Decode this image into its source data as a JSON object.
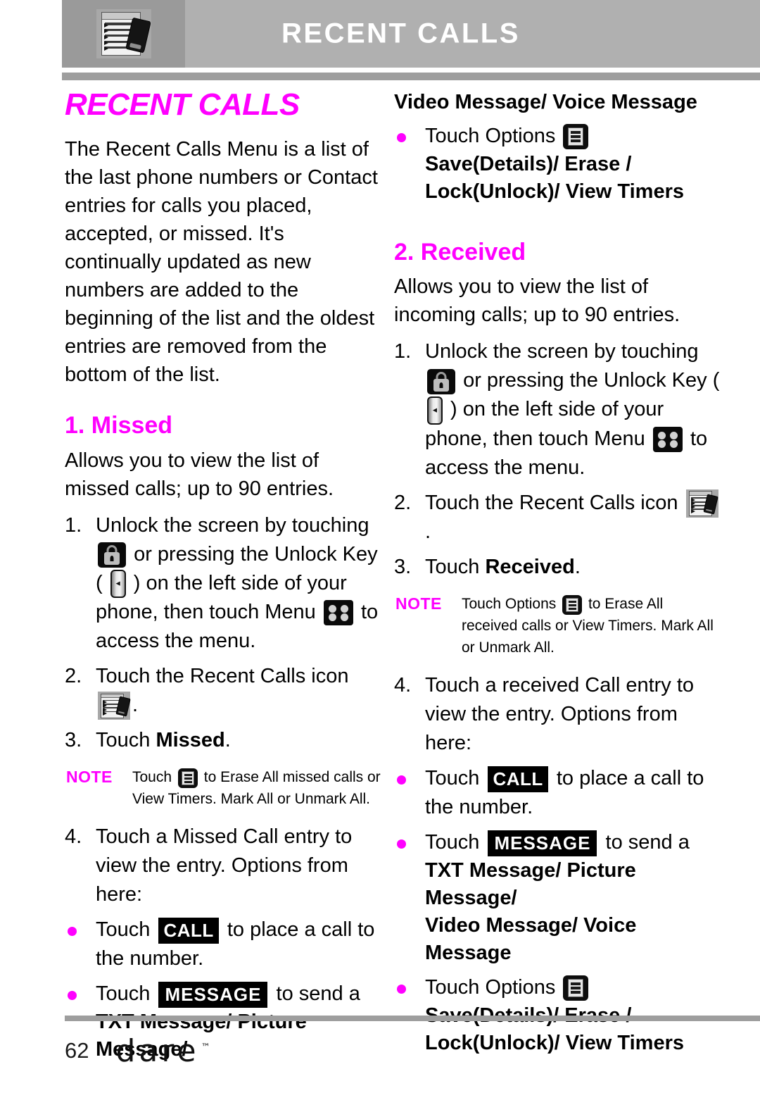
{
  "header": {
    "title": "RECENT CALLS",
    "icon": "recent-calls-document-phone-icon",
    "band_color": "#b0b0b0",
    "tile_color": "#9a9a9a",
    "title_color": "#ffffff"
  },
  "theme": {
    "accent": "#ff00ff",
    "text": "#000000",
    "rule": "#9e9e9e"
  },
  "left_column": {
    "page_heading": "RECENT CALLS",
    "intro": "The Recent Calls Menu is a list of the last phone numbers or Contact entries for calls you placed, accepted, or missed. It's continually updated as new numbers are added to the beginning of the list and the oldest entries are removed from the bottom of the list.",
    "section": {
      "heading": "1. Missed",
      "description": "Allows you to view the list of missed calls; up to 90 entries.",
      "steps": [
        {
          "num": "1.",
          "parts": {
            "a": "Unlock the screen by touching",
            "b": "or pressing the Unlock Key",
            "c": "( ",
            "d": " ) on the left side of your phone, then touch Menu",
            "e": "to access the menu."
          }
        },
        {
          "num": "2.",
          "parts": {
            "a": "Touch the Recent Calls icon",
            "b": "."
          }
        },
        {
          "num": "3.",
          "parts": {
            "a": "Touch ",
            "bold": "Missed",
            "b": "."
          }
        }
      ],
      "note": {
        "label": "NOTE",
        "line1_pre": "Touch",
        "line1_post": "to Erase All missed calls or",
        "line2": "View Timers. Mark All or Unmark All."
      },
      "step4": {
        "num": "4.",
        "text": "Touch a Missed Call entry to view the entry. Options from here:"
      },
      "bullets": [
        {
          "pre": "Touch",
          "badge": "CALL",
          "post": "to place a call to the number."
        },
        {
          "pre": "Touch",
          "badge": "MESSAGE",
          "post": "to send a",
          "bold_line": "TXT Message/ Picture Message/"
        }
      ]
    }
  },
  "right_column": {
    "continued_bold": "Video Message/ Voice Message",
    "continued_bullet": {
      "pre": "Touch Options",
      "bold_line1": "Save(Details)/ Erase /",
      "bold_line2": "Lock(Unlock)/ View Timers"
    },
    "section": {
      "heading": "2. Received",
      "description": "Allows you to view the list of incoming calls; up to 90 entries.",
      "steps": [
        {
          "num": "1.",
          "parts": {
            "a": "Unlock the screen by touching",
            "b": "or pressing the Unlock Key",
            "c": "( ",
            "d": " ) on the left side of your phone, then touch Menu",
            "e": "to access the menu."
          }
        },
        {
          "num": "2.",
          "parts": {
            "a": "Touch the Recent Calls icon",
            "b": "."
          }
        },
        {
          "num": "3.",
          "parts": {
            "a": "Touch ",
            "bold": "Received",
            "b": "."
          }
        }
      ],
      "note": {
        "label": "NOTE",
        "line1_pre": "Touch Options",
        "line1_post": "to Erase All",
        "line2": "received calls or View Timers. Mark All",
        "line3": "or Unmark All."
      },
      "step4": {
        "num": "4.",
        "text": "Touch a received Call entry to view the entry. Options from here:"
      },
      "bullets": [
        {
          "pre": "Touch",
          "badge": "CALL",
          "post": "to place a call to the number."
        },
        {
          "pre": "Touch",
          "badge": "MESSAGE",
          "post": "to send a",
          "bold_line1": "TXT Message/ Picture Message/",
          "bold_line2": "Video Message/ Voice Message"
        },
        {
          "pre": "Touch Options",
          "bold_line1": "Save(Details)/ Erase /",
          "bold_line2": "Lock(Unlock)/ View Timers"
        }
      ]
    }
  },
  "footer": {
    "page_number": "62",
    "brand": "Dare",
    "trademark": "™"
  },
  "icons": {
    "lock": "lock-icon",
    "unlock_key": "unlock-key-icon",
    "menu": "menu-grid-icon",
    "options": "options-list-icon",
    "recent_calls": "recent-calls-icon"
  }
}
